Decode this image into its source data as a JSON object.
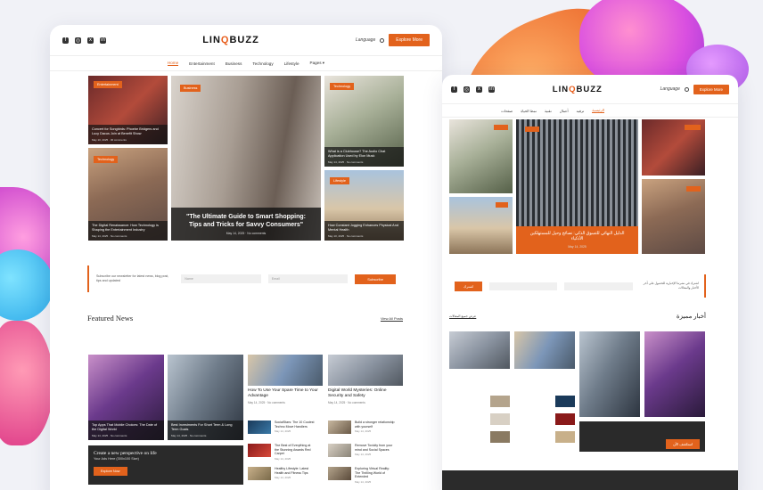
{
  "brand": {
    "logo_left": "LIN",
    "logo_q": "Q",
    "logo_right": "BUZZ"
  },
  "colors": {
    "accent": "#e2621c",
    "dark": "#2b2b2b"
  },
  "header": {
    "social_icons": [
      "facebook-icon",
      "instagram-icon",
      "x-icon",
      "linkedin-icon"
    ],
    "language_label": "Language",
    "cta_label": "Explore More"
  },
  "nav": {
    "items": [
      "Home",
      "Entertainment",
      "Business",
      "Technology",
      "Lifestyle",
      "Pages ▾"
    ]
  },
  "hero": {
    "left_top": {
      "tag": "Entertainment",
      "title": "Concert for Songbirds: Phoebe Bridgers and Lucy Dacus Join at Benefit Show",
      "meta": "May 10, 2025 · 30 comments"
    },
    "left_bottom": {
      "tag": "Technology",
      "title": "The Digital Renaissance: How Technology is Shaping the Entertainment Industry",
      "meta": "May 14, 2025 · No comments"
    },
    "center": {
      "tag": "Business",
      "title": "\"The Ultimate Guide to Smart Shopping: Tips and Tricks for Savvy Consumers\"",
      "meta": "May 14, 2025 · No comments"
    },
    "right_top": {
      "tag": "Technology",
      "title": "What is a Clubhouse? The Audio Chat Application Used by Elon Musk",
      "meta": "May 14, 2025 · No comments"
    },
    "right_bottom": {
      "tag": "Lifestyle",
      "title": "How Constant Jogging Enhances Physical And Mental Health",
      "meta": "May 10, 2025 · No comments"
    }
  },
  "subscribe": {
    "text": "Subscribe our newsletter for latest news, blog post, tips and updates!",
    "name_placeholder": "Name",
    "email_placeholder": "Email",
    "button": "Subscribe"
  },
  "featured": {
    "heading": "Featured News",
    "view_all": "View All Posts",
    "card1": {
      "title": "Top Apps That Mobile Choices: The Date of the Digital World",
      "meta": "May 14, 2025 · No comments"
    },
    "card2": {
      "title": "Best Investments For Short Term & Long Term Goals",
      "meta": "May 14, 2025 · No comments"
    },
    "col3": {
      "title": "How To Use Your Spare Time to Your Advantage",
      "meta": "May 14, 2025 · No comments"
    },
    "col4": {
      "title": "Digital World Mysteries: Online Security and Safety",
      "meta": "May 14, 2025 · No comments"
    },
    "list_left": [
      {
        "title": "SocialStars: The 10 Coolest Techno Move Handlers",
        "meta": "May 14, 2025"
      },
      {
        "title": "The Best of Everything at the Stunning Awards Red Carpet",
        "meta": "May 14, 2025"
      },
      {
        "title": "Healthy Lifestyle: Latest Health and Fitness Tips",
        "meta": "May 14, 2025"
      }
    ],
    "list_right": [
      {
        "title": "Build a stronger relationship with yourself",
        "meta": "May 14, 2025"
      },
      {
        "title": "Remove Toxicity from your mind and Social Spaces",
        "meta": "May 14, 2025"
      },
      {
        "title": "Exploring Virtual Reality: The Thrilling World of Extended",
        "meta": "May 14, 2025"
      }
    ],
    "cta": {
      "title": "Create a new perspective on life",
      "sub": "Your Ads Here (300x100 Size)",
      "button": "Explore Now"
    }
  },
  "rtl": {
    "language_label": "Language",
    "cta_label": "Explore More",
    "nav": [
      "الرئيسية",
      "ترفيه",
      "أعمال",
      "تقنية",
      "نمط الحياة",
      "صفحات"
    ],
    "center_title": "الدليل النهائي للتسوق الذكي: نصائح وحيل للمستهلكين الأذكياء",
    "center_meta": "May 14, 2025",
    "subscribe_button": "اشترك",
    "subscribe_text": "اشترك في نشرتنا الإخبارية للحصول على آخر الأخبار والمقالات",
    "heading": "أخبار مميزة",
    "view_all": "عرض جميع المقالات",
    "cta_button": "استكشف الآن"
  }
}
